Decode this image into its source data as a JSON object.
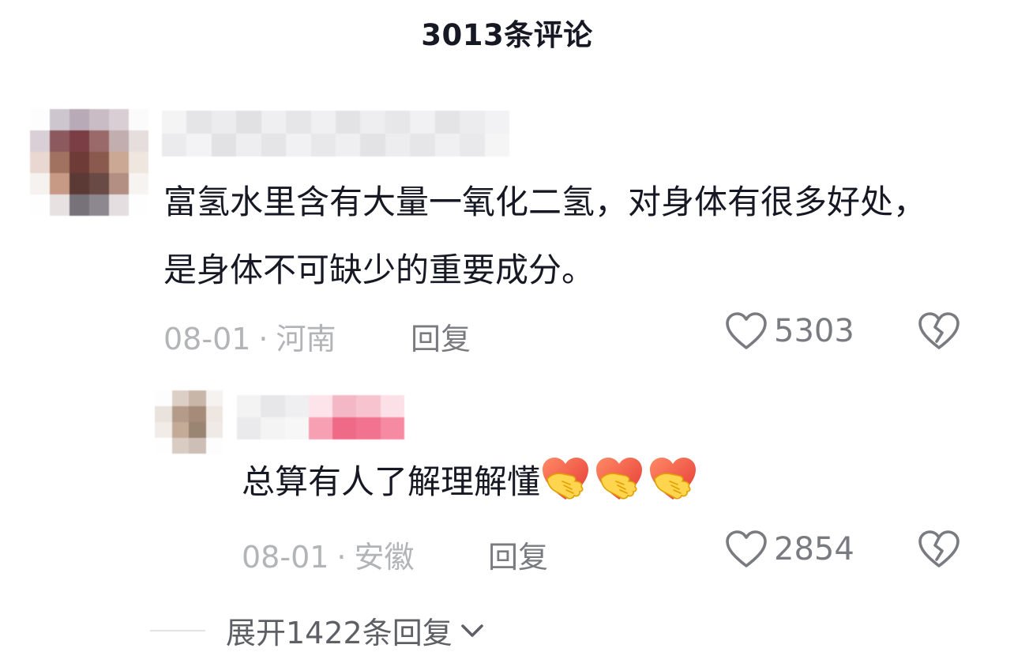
{
  "header": {
    "title": "3013条评论"
  },
  "comment": {
    "text": "富氢水里含有大量一氧化二氢，对身体有很多好处，是身体不可缺少的重要成分。",
    "date": "08-01",
    "separator": "·",
    "region": "河南",
    "reply_label": "回复",
    "likes": "5303",
    "like_icon": "heart-outline-icon",
    "dislike_icon": "broken-heart-icon"
  },
  "reply": {
    "text": "总算有人了解理解懂",
    "emoji": "handshake-heart-emoji",
    "emoji_count": 3,
    "date": "08-01",
    "separator": "·",
    "region": "安徽",
    "reply_label": "回复",
    "likes": "2854",
    "like_icon": "heart-outline-icon",
    "dislike_icon": "broken-heart-icon"
  },
  "expand": {
    "label": "展开1422条回复",
    "icon": "chevron-down-icon"
  }
}
